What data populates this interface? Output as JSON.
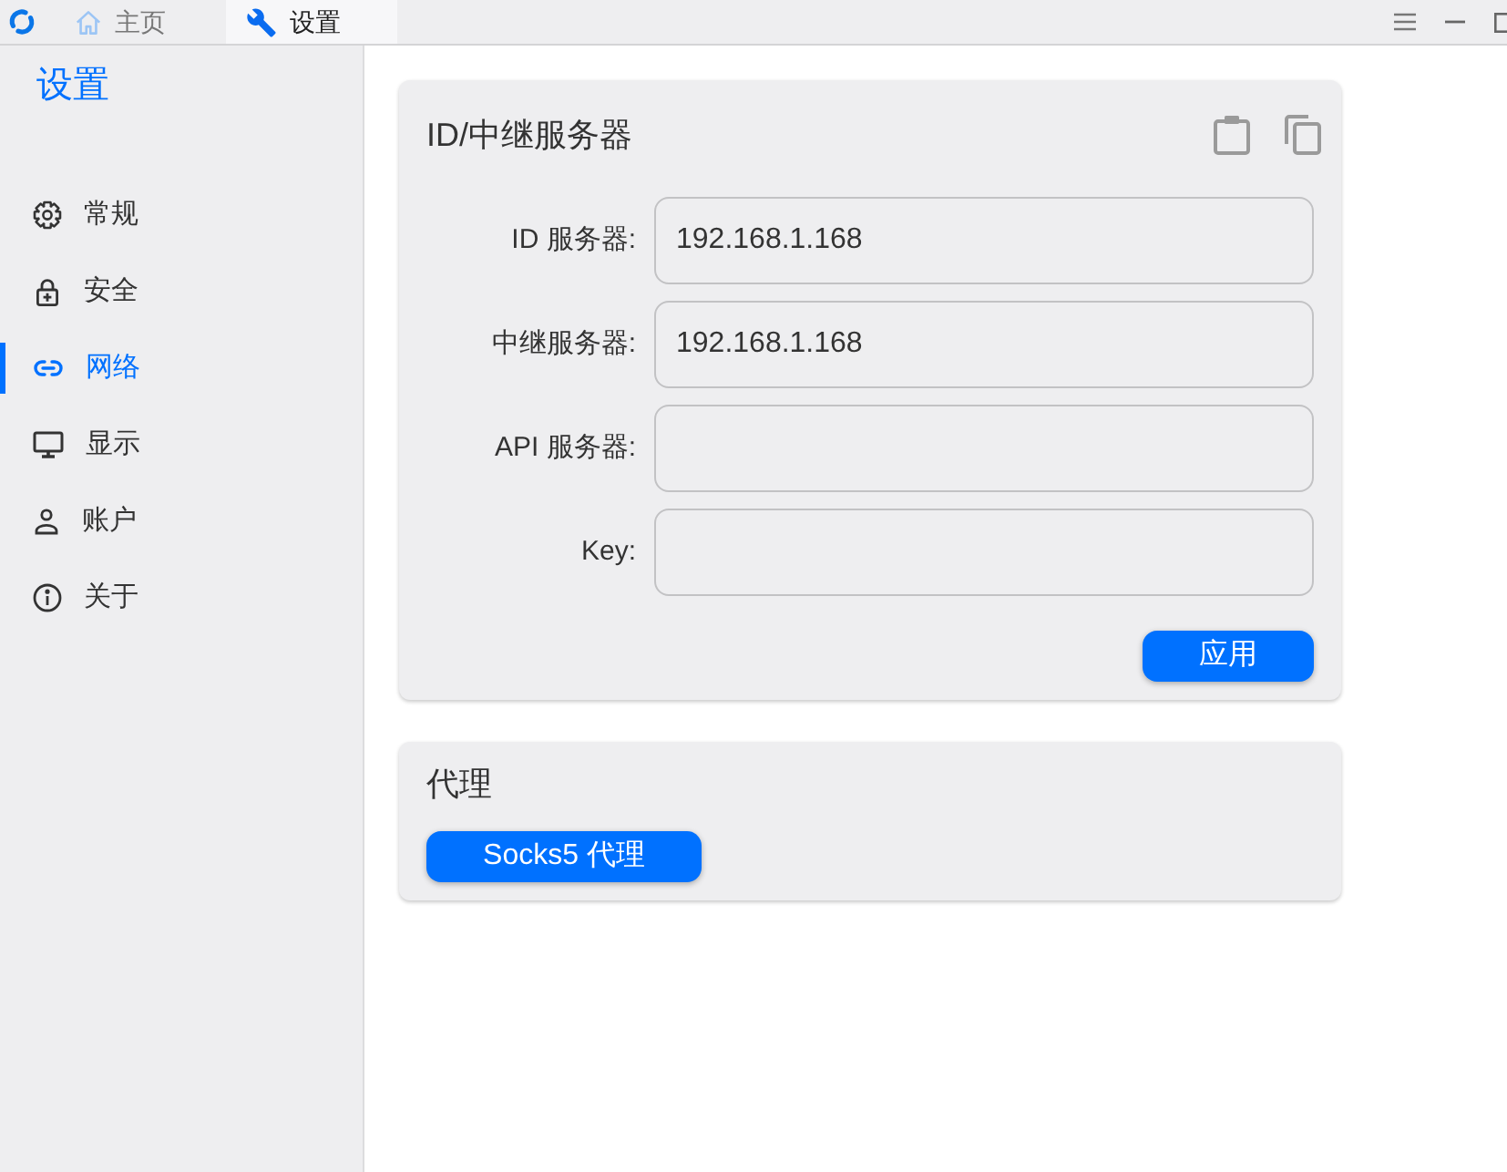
{
  "title_bar": {
    "tabs": [
      {
        "label": "主页",
        "selected": false
      },
      {
        "label": "设置",
        "selected": true
      }
    ]
  },
  "sidebar": {
    "title": "设置",
    "items": [
      {
        "label": "常规",
        "selected": false
      },
      {
        "label": "安全",
        "selected": false
      },
      {
        "label": "网络",
        "selected": true
      },
      {
        "label": "显示",
        "selected": false
      },
      {
        "label": "账户",
        "selected": false
      },
      {
        "label": "关于",
        "selected": false
      }
    ]
  },
  "server_card": {
    "title": "ID/中继服务器",
    "fields": [
      {
        "label": "ID 服务器:",
        "value": "192.168.1.168"
      },
      {
        "label": "中继服务器:",
        "value": "192.168.1.168"
      },
      {
        "label": "API 服务器:"
      },
      {
        "label": "Key:"
      }
    ],
    "apply_button": "应用"
  },
  "proxy_card": {
    "title": "代理",
    "button": "Socks5 代理"
  }
}
